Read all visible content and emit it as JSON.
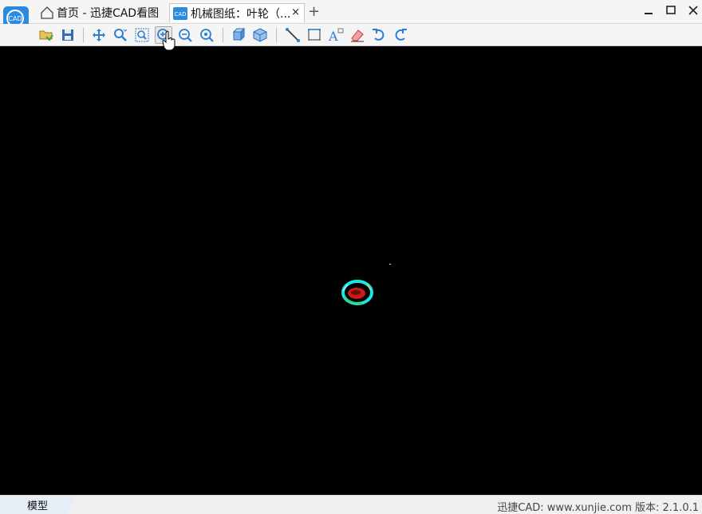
{
  "app": {
    "logo_text": "CAD"
  },
  "tabs": [
    {
      "label": "首页 - 迅捷CAD看图",
      "icon": "home-icon"
    },
    {
      "label": "机械图纸：叶轮（...",
      "icon": "cad-document-icon",
      "close": "×"
    }
  ],
  "new_tab_label": "+",
  "toolbar": {
    "buttons": [
      {
        "name": "open",
        "icon": "folder-open-icon"
      },
      {
        "name": "save",
        "icon": "save-icon"
      },
      {
        "name": "pan",
        "icon": "pan-icon"
      },
      {
        "name": "zoom-realtime",
        "icon": "zoom-realtime-icon"
      },
      {
        "name": "zoom-window",
        "icon": "zoom-window-icon"
      },
      {
        "name": "zoom-in",
        "icon": "zoom-in-icon"
      },
      {
        "name": "zoom-out",
        "icon": "zoom-out-icon"
      },
      {
        "name": "zoom-extents",
        "icon": "zoom-extents-icon"
      },
      {
        "name": "3d-view",
        "icon": "cube-icon"
      },
      {
        "name": "3d-orbit",
        "icon": "cube-orbit-icon"
      },
      {
        "name": "measure-length",
        "icon": "measure-line-icon"
      },
      {
        "name": "measure-dimension",
        "icon": "dimension-icon"
      },
      {
        "name": "text",
        "icon": "text-icon"
      },
      {
        "name": "eraser",
        "icon": "eraser-icon"
      },
      {
        "name": "undo",
        "icon": "undo-icon"
      },
      {
        "name": "redo",
        "icon": "redo-icon"
      }
    ]
  },
  "status": {
    "model_tab": "模型",
    "info": "迅捷CAD: www.xunjie.com 版本: 2.1.0.1"
  },
  "colors": {
    "canvas_bg": "#000000",
    "accent": "#2a7fd4",
    "drawing_cyan": "#19e6e6",
    "drawing_red": "#cc1a1a"
  }
}
